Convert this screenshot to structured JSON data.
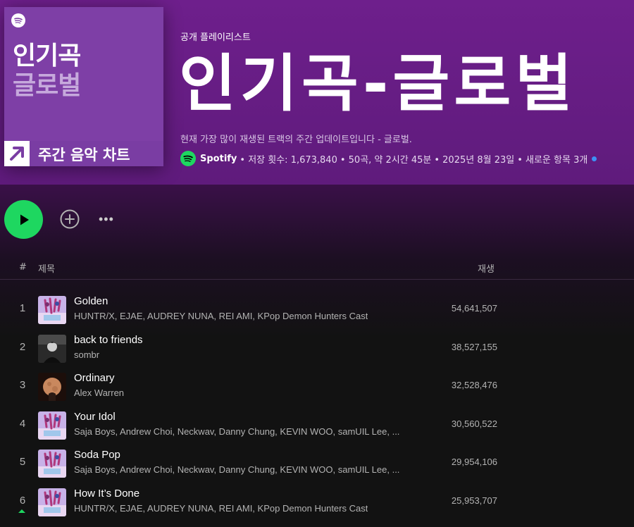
{
  "cover": {
    "title_line1": "인기곡",
    "title_line2": "글로벌",
    "band_label": "주간 음악 차트"
  },
  "header": {
    "kind": "공개 플레이리스트",
    "title": "인기곡-글로벌",
    "description": "현재 가장 많이 재생된 트랙의 주간 업데이트입니다 - 글로벌.",
    "owner": "Spotify",
    "saves": "• 저장 횟수: 1,673,840",
    "count_duration": "• 50곡, 약 2시간 45분",
    "date": "• 2025년 8월 23일",
    "new_items": "• 새로운 항목 3개"
  },
  "actions": {
    "play_icon": "play-icon",
    "add_icon": "plus-circle-icon",
    "more_label": "•••"
  },
  "table": {
    "col_num": "#",
    "col_title": "제목",
    "col_plays": "재생"
  },
  "tracks": [
    {
      "num": "1",
      "title": "Golden",
      "artists": "HUNTR/X, EJAE, AUDREY NUNA, REI AMI, KPop Demon Hunters Cast",
      "plays": "54,641,507",
      "art": "kpop"
    },
    {
      "num": "2",
      "title": "back to friends",
      "artists": "sombr",
      "plays": "38,527,155",
      "art": "sombr"
    },
    {
      "num": "3",
      "title": "Ordinary",
      "artists": "Alex Warren",
      "plays": "32,528,476",
      "art": "ordinary"
    },
    {
      "num": "4",
      "title": "Your Idol",
      "artists": "Saja Boys, Andrew Choi, Neckwav, Danny Chung, KEVIN WOO, samUIL Lee, ...",
      "plays": "30,560,522",
      "art": "kpop"
    },
    {
      "num": "5",
      "title": "Soda Pop",
      "artists": "Saja Boys, Andrew Choi, Neckwav, Danny Chung, KEVIN WOO, samUIL Lee, ...",
      "plays": "29,954,106",
      "art": "kpop"
    },
    {
      "num": "6",
      "title": "How It’s Done",
      "artists": "HUNTR/X, EJAE, AUDREY NUNA, REI AMI, KPop Demon Hunters Cast",
      "plays": "25,953,707",
      "art": "kpop",
      "trend": "up"
    }
  ],
  "colors": {
    "accent": "#1ed760",
    "hero": "#6e1f8c",
    "cover": "#7e3fa6",
    "new_dot": "#3d91f4"
  }
}
